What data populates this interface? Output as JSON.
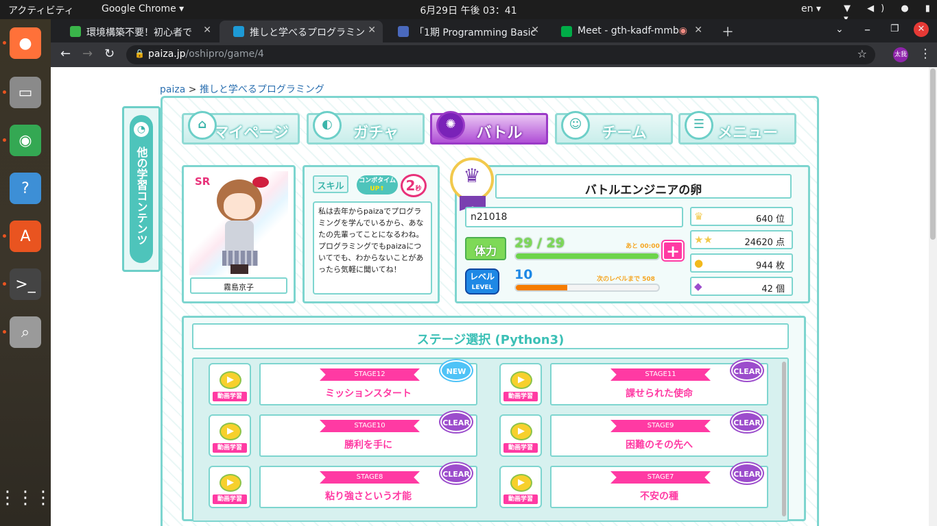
{
  "topbar": {
    "activities": "アクティビティ",
    "app": "Google Chrome ▾",
    "clock": "6月29日  午後 03：41",
    "lang": "en ▾",
    "indicators": "▼ ◀) ● ▮ ▾"
  },
  "dock": [
    {
      "name": "firefox",
      "glyph": "●",
      "color": "#ff7139"
    },
    {
      "name": "files",
      "glyph": "▭",
      "color": "#8a8a8a"
    },
    {
      "name": "chrome",
      "glyph": "◉",
      "color": "#34a853"
    },
    {
      "name": "help",
      "glyph": "?",
      "color": "#3d8fd6"
    },
    {
      "name": "software",
      "glyph": "A",
      "color": "#e95420"
    },
    {
      "name": "terminal",
      "glyph": ">_",
      "color": "#444"
    },
    {
      "name": "search",
      "glyph": "⌕",
      "color": "#9a9a9a"
    }
  ],
  "browser": {
    "tabs": [
      {
        "title": "環境構築不要！初心者で",
        "color": "#3ab54a"
      },
      {
        "title": "推しと学べるプログラミン",
        "color": "#1d9ad6"
      },
      {
        "title": "「1期 Programming Basic",
        "color": "#4a69bd"
      },
      {
        "title": "Meet - gth-kadf-mmb",
        "color": "#00ac47"
      }
    ],
    "url_host": "paiza.jp",
    "url_path": "/oshipro/game/4",
    "profile": "太我"
  },
  "page": {
    "breadcrumb_root": "paiza",
    "breadcrumb_sep": " > ",
    "breadcrumb_current": "推しと学べるプログラミング",
    "side_label": "他の学習コンテンツ",
    "nav": [
      "マイページ",
      "ガチャ",
      "バトル",
      "チーム",
      "メニュー"
    ],
    "character": {
      "rarity": "SR",
      "name": "霧島京子"
    },
    "skill": {
      "label": "スキル",
      "combo": "コンボタイム",
      "up": "UP⇑",
      "seconds": "2",
      "sec_unit": "秒",
      "text": "私は去年からpaizaでプログラミングを学んでいるから、あなたの先輩ってことになるわね。プログラミングでもpaizaについてでも、わからないことがあったら気軽に聞いてね！"
    },
    "status": {
      "title": "バトルエンジニアの卵",
      "user_id": "n21018",
      "hp_label": "体力",
      "hp_value": "29 / 29",
      "hp_hint": "あと 00:00",
      "hp_fraction": 1.0,
      "level_label": "レベル",
      "level_en": "LEVEL",
      "level_value": "10",
      "level_hint": "次のレベルまで 508",
      "level_fraction": 0.36,
      "rank": "640 位",
      "points": "24620 点",
      "coins": "944 枚",
      "gems": "42 個"
    },
    "stage_title": "ステージ選択 (Python3)",
    "video_label": "動画学習",
    "stages": [
      {
        "code": "STAGE12",
        "name": "ミッションスタート",
        "badge": "NEW",
        "kind": "new"
      },
      {
        "code": "STAGE11",
        "name": "課せられた使命",
        "badge": "CLEAR",
        "kind": "clear"
      },
      {
        "code": "STAGE10",
        "name": "勝利を手に",
        "badge": "CLEAR",
        "kind": "clear"
      },
      {
        "code": "STAGE9",
        "name": "困難のその先へ",
        "badge": "CLEAR",
        "kind": "clear"
      },
      {
        "code": "STAGE8",
        "name": "粘り強さという才能",
        "badge": "CLEAR",
        "kind": "clear"
      },
      {
        "code": "STAGE7",
        "name": "不安の種",
        "badge": "CLEAR",
        "kind": "clear"
      }
    ]
  }
}
